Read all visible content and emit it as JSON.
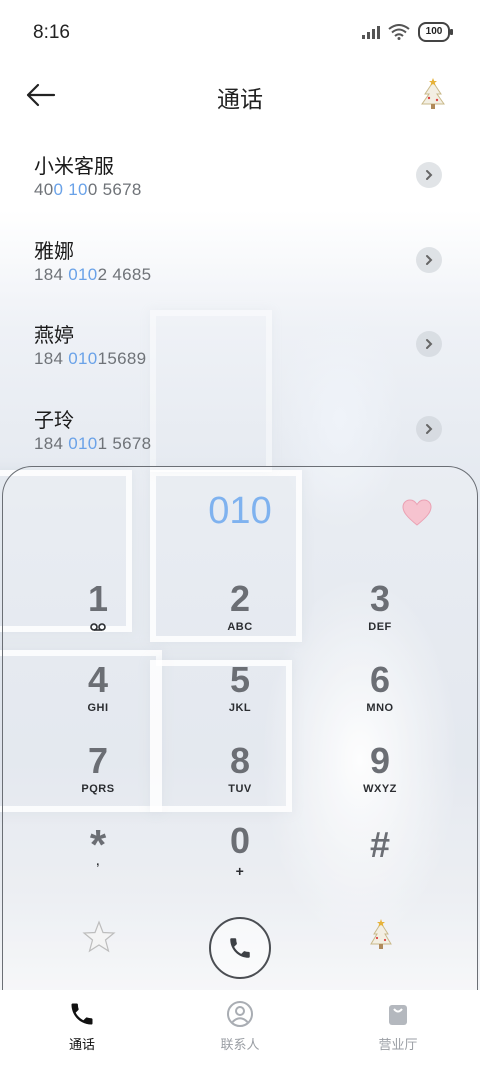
{
  "status_bar": {
    "time": "8:16",
    "battery": "100"
  },
  "header": {
    "title": "通话"
  },
  "contacts": [
    {
      "name": "小米客服",
      "number_parts": [
        "40",
        "0 10",
        "0 5678"
      ]
    },
    {
      "name": "雅娜",
      "number_parts": [
        "184 ",
        "010",
        "2 4685"
      ]
    },
    {
      "name": "燕婷",
      "number_parts": [
        "184 ",
        "010",
        "15689"
      ]
    },
    {
      "name": "子玲",
      "number_parts": [
        "184 ",
        "010",
        "1 5678"
      ]
    }
  ],
  "dialer": {
    "typed_number": "010",
    "keys": [
      {
        "digit": "1",
        "letters": ""
      },
      {
        "digit": "2",
        "letters": "ABC"
      },
      {
        "digit": "3",
        "letters": "DEF"
      },
      {
        "digit": "4",
        "letters": "GHI"
      },
      {
        "digit": "5",
        "letters": "JKL"
      },
      {
        "digit": "6",
        "letters": "MNO"
      },
      {
        "digit": "7",
        "letters": "PQRS"
      },
      {
        "digit": "8",
        "letters": "TUV"
      },
      {
        "digit": "9",
        "letters": "WXYZ"
      },
      {
        "digit": "*",
        "letters": ","
      },
      {
        "digit": "0",
        "letters": "+"
      },
      {
        "digit": "#",
        "letters": ""
      }
    ]
  },
  "tabs": [
    {
      "label": "通话",
      "active": true
    },
    {
      "label": "联系人",
      "active": false
    },
    {
      "label": "营业厅",
      "active": false
    }
  ],
  "colors": {
    "highlight": "#6aa2e8",
    "typed_number": "#7fb2ef",
    "active_tab": "#111111",
    "inactive_tab": "#9a9ea4"
  }
}
